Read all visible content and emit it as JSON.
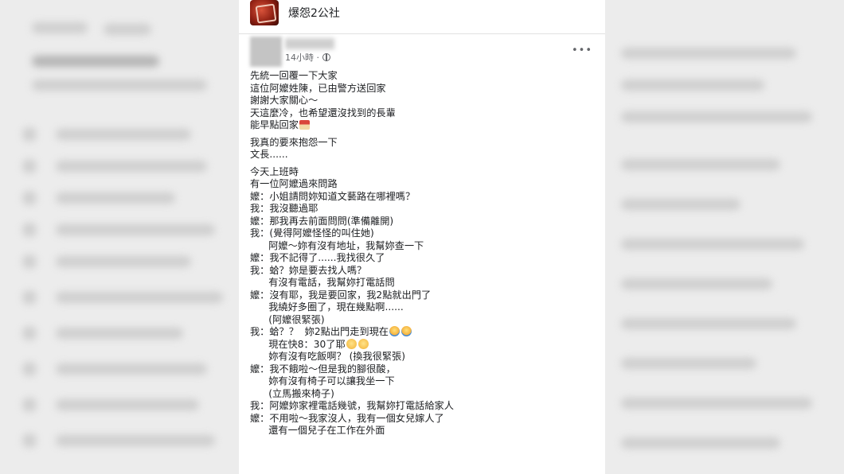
{
  "group": {
    "name": "爆怨2公社"
  },
  "post": {
    "timestamp": "14小時 · ",
    "more_label": "•••",
    "lines": [
      "先統一回覆一下大家",
      "這位阿嬤姓陳，已由警方送回家",
      "謝謝大家關心～",
      "天這麼冷，也希望還沒找到的長輩",
      "能早點回家",
      "",
      "我真的要來抱怨一下",
      "文長......",
      "",
      "今天上班時",
      "有一位阿嬤過來問路",
      "嬤：小姐請問妳知道文藝路在哪裡嗎？",
      "我：我沒聽過耶",
      "嬤：那我再去前面問問(準備離開)",
      "我：(覺得阿嬤怪怪的叫住她)",
      "      阿嬤～妳有沒有地址，我幫妳查一下",
      "嬤：我不記得了......我找很久了",
      "我：蛤？妳是要去找人嗎？",
      "      有沒有電話，我幫妳打電話問",
      "嬤：沒有耶，我是要回家，我2點就出門了",
      "      我繞好多圈了，現在幾點啊......",
      "      (阿嬤很緊張)",
      "我：蛤？？  妳2點出門走到現在",
      "      現在快8：30了耶",
      "      妳有沒有吃飯啊？ (換我很緊張)",
      "嬤：我不餓啦～但是我的腳很酸，",
      "      妳有沒有椅子可以讓我坐一下",
      "      (立馬搬來椅子)",
      "我：阿嬤妳家裡電話幾號，我幫妳打電話給家人",
      "嬤：不用啦～我家沒人，我有一個女兒嫁人了",
      "      還有一個兒子在工作在外面"
    ]
  },
  "icons": {
    "globe": "globe-icon",
    "house": "house-emoji",
    "scream": "scream-emoji",
    "sweat": "sweat-smile-emoji",
    "more": "more-icon"
  }
}
